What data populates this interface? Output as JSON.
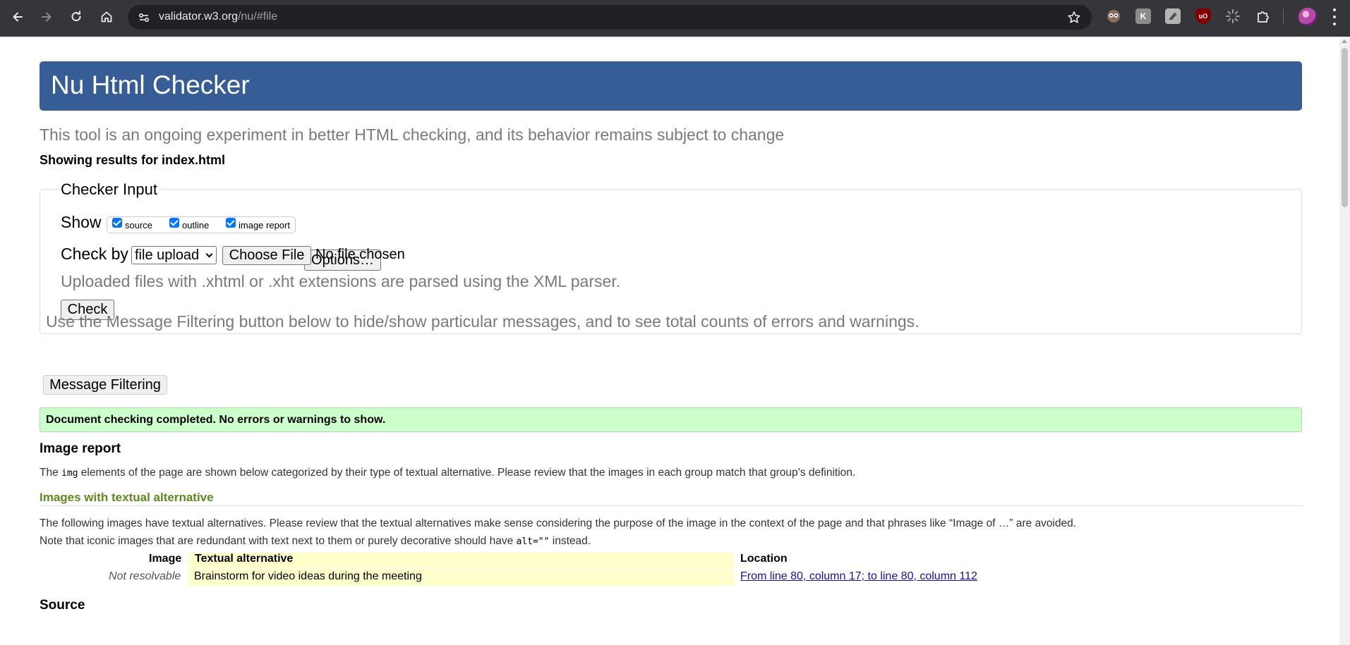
{
  "browser": {
    "url_host": "validator.w3.org",
    "url_path": "/nu/#file",
    "extensions": [
      "mask-extension-icon",
      "k-extension-icon",
      "pen-extension-icon",
      "ublock-icon",
      "sun-extension-icon",
      "puzzle-icon"
    ]
  },
  "page": {
    "title": "Nu Html Checker",
    "subtitle": "This tool is an ongoing experiment in better HTML checking, and its behavior remains subject to change",
    "results_for": "Showing results for index.html"
  },
  "checker_input": {
    "legend": "Checker Input",
    "show_label": "Show",
    "show_options": [
      {
        "label": "source",
        "checked": true
      },
      {
        "label": "outline",
        "checked": true
      },
      {
        "label": "image report",
        "checked": true
      }
    ],
    "options_button": "Options…",
    "check_by_label": "Check by",
    "check_by_value": "file upload",
    "choose_file_button": "Choose File",
    "file_status": "No file chosen",
    "xml_hint": "Uploaded files with .xhtml or .xht extensions are parsed using the XML parser.",
    "check_button": "Check"
  },
  "filtering": {
    "hint": "Use the Message Filtering button below to hide/show particular messages, and to see total counts of errors and warnings.",
    "button": "Message Filtering"
  },
  "result": {
    "success_message": "Document checking completed. No errors or warnings to show."
  },
  "image_report": {
    "heading": "Image report",
    "intro_before": "The ",
    "intro_code": "img",
    "intro_after": " elements of the page are shown below categorized by their type of textual alternative. Please review that the images in each group match that group’s definition.",
    "group_heading": "Images with textual alternative",
    "group_text_1": "The following images have textual alternatives. Please review that the textual alternatives make sense considering the purpose of the image in the context of the page and that phrases like “Image of …” are avoided.",
    "group_text_2_before": "Note that iconic images that are redundant with text next to them or purely decorative should have ",
    "group_text_2_code": "alt=\"\"",
    "group_text_2_after": " instead.",
    "columns": [
      "Image",
      "Textual alternative",
      "Location"
    ],
    "rows": [
      {
        "image": "Not resolvable",
        "alt": "Brainstorm for video ideas during the meeting",
        "location": "From line 80, column 17; to line 80, column 112"
      }
    ]
  },
  "source": {
    "heading": "Source"
  }
}
